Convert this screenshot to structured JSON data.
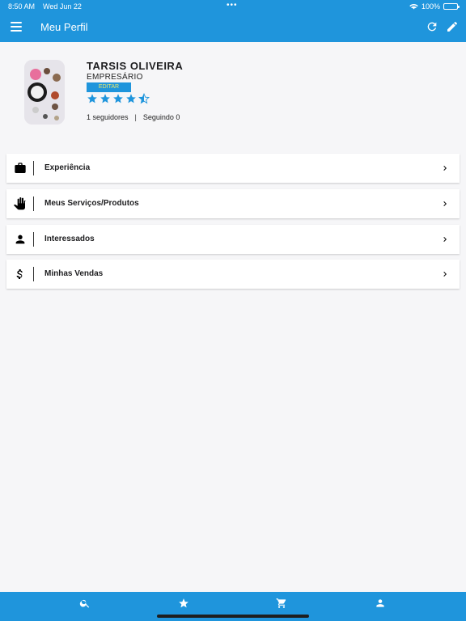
{
  "status_bar": {
    "time": "8:50 AM",
    "date": "Wed Jun 22",
    "dots": "•••",
    "battery": "100%"
  },
  "appbar": {
    "title": "Meu Perfil",
    "menu_icon": "hamburger-menu-icon",
    "refresh_icon": "refresh-icon",
    "edit_icon": "pencil-icon"
  },
  "profile": {
    "name": "TARSIS OLIVEIRA",
    "role": "EMPRESÁRIO",
    "edit_label": "EDITAR",
    "rating": 4.5,
    "followers_text": "1 seguidores",
    "separator": "|",
    "following_text": "Seguindo 0"
  },
  "menu": [
    {
      "label": "Experiência",
      "icon": "briefcase-icon"
    },
    {
      "label": "Meus Serviços/Produtos",
      "icon": "hand-icon"
    },
    {
      "label": "Interessados",
      "icon": "person-icon"
    },
    {
      "label": "Minhas Vendas",
      "icon": "dollar-icon"
    }
  ],
  "tabs": [
    {
      "name": "search-icon"
    },
    {
      "name": "star-icon"
    },
    {
      "name": "cart-icon"
    },
    {
      "name": "person-icon"
    }
  ],
  "colors": {
    "primary": "#1f95dc",
    "badge_text": "#f0e86a",
    "background": "#f6f6f8"
  }
}
